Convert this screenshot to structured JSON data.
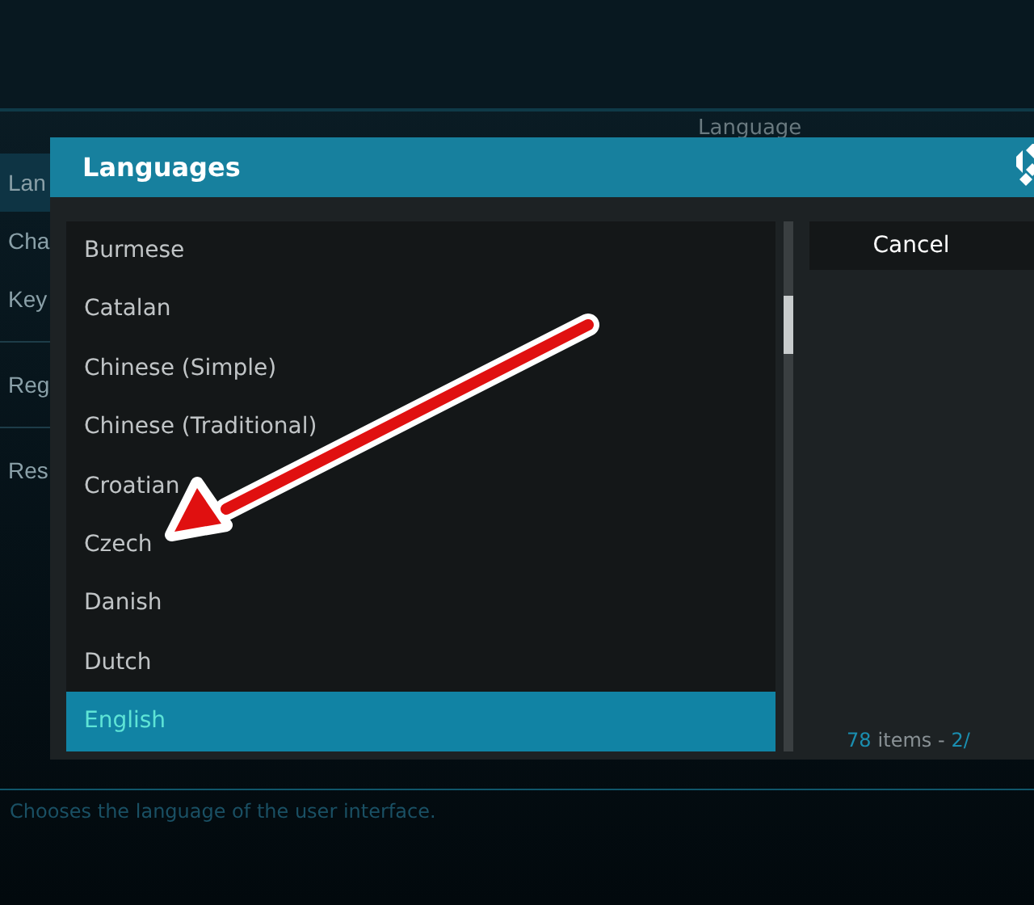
{
  "background": {
    "sidebar_groups": [
      [
        {
          "label": "Lan",
          "selected": true
        },
        {
          "label": "Cha",
          "selected": false
        },
        {
          "label": "Key",
          "selected": false
        }
      ],
      [
        {
          "label": "Reg",
          "selected": false
        }
      ],
      [
        {
          "label": "Res",
          "selected": false
        }
      ]
    ],
    "section_label": "Language",
    "description": "Chooses the language of the user interface."
  },
  "dialog": {
    "title": "Languages",
    "items": [
      {
        "label": "Burmese",
        "selected": false
      },
      {
        "label": "Catalan",
        "selected": false
      },
      {
        "label": "Chinese (Simple)",
        "selected": false
      },
      {
        "label": "Chinese (Traditional)",
        "selected": false
      },
      {
        "label": "Croatian",
        "selected": false
      },
      {
        "label": "Czech",
        "selected": false
      },
      {
        "label": "Danish",
        "selected": false
      },
      {
        "label": "Dutch",
        "selected": false
      },
      {
        "label": "English",
        "selected": true
      }
    ],
    "button": "Cancel",
    "count": "78",
    "count_label": "items -",
    "page": "2/"
  }
}
